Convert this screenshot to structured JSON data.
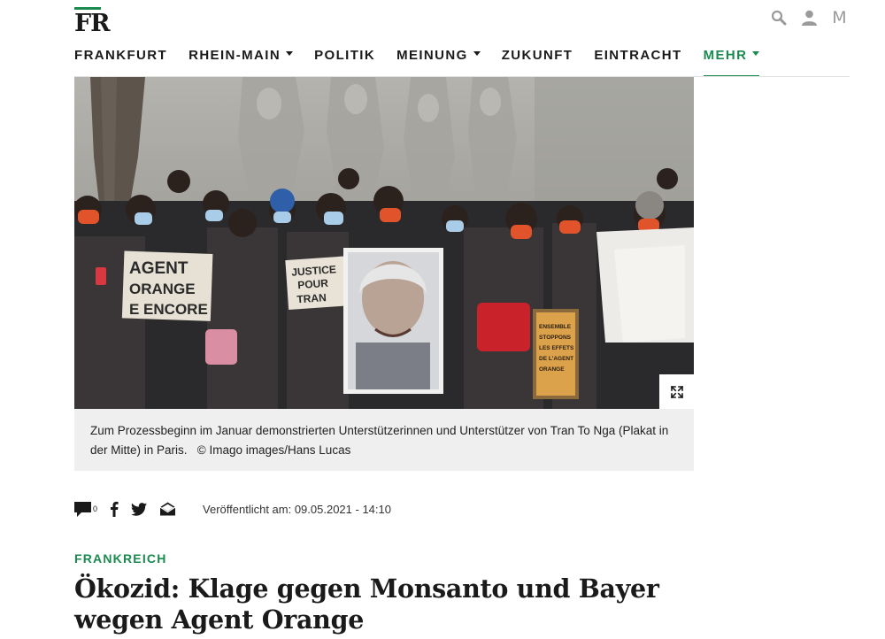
{
  "logo": {
    "text": "FR"
  },
  "header_icons": [
    "search-icon",
    "user-icon",
    "m-icon"
  ],
  "header_m_letter": "M",
  "nav": {
    "items": [
      {
        "label": "FRANKFURT",
        "dropdown": false
      },
      {
        "label": "RHEIN-MAIN",
        "dropdown": true
      },
      {
        "label": "POLITIK",
        "dropdown": false
      },
      {
        "label": "MEINUNG",
        "dropdown": true
      },
      {
        "label": "ZUKUNFT",
        "dropdown": false
      },
      {
        "label": "EINTRACHT",
        "dropdown": false
      },
      {
        "label": "MEHR",
        "dropdown": true,
        "active": true
      }
    ]
  },
  "photo": {
    "placard_left": [
      "AGENT",
      "ORANGE",
      "E ENCORE"
    ],
    "placard_mid": [
      "JUSTICE",
      "POUR",
      "TRAN"
    ],
    "placard_right": [
      "ENSEMBLE",
      "STOPPONS",
      "LES EFFETS",
      "DE L'AGENT",
      "ORANGE"
    ]
  },
  "caption": {
    "text": "Zum Prozessbeginn im Januar demonstrierten Unterstützerinnen und Unterstützer von Tran To Nga (Plakat in der Mitte) in Paris.",
    "credit": "© Imago images/Hans Lucas"
  },
  "share": {
    "comment_count": "0",
    "published_label": "Veröffentlicht am: 09.05.2021 - 14:10"
  },
  "article": {
    "kicker": "FRANKREICH",
    "headline": "Ökozid: Klage gegen Monsanto und Bayer wegen Agent Orange"
  },
  "colors": {
    "accent": "#1a8a4f",
    "caption_bg": "#efefef"
  }
}
